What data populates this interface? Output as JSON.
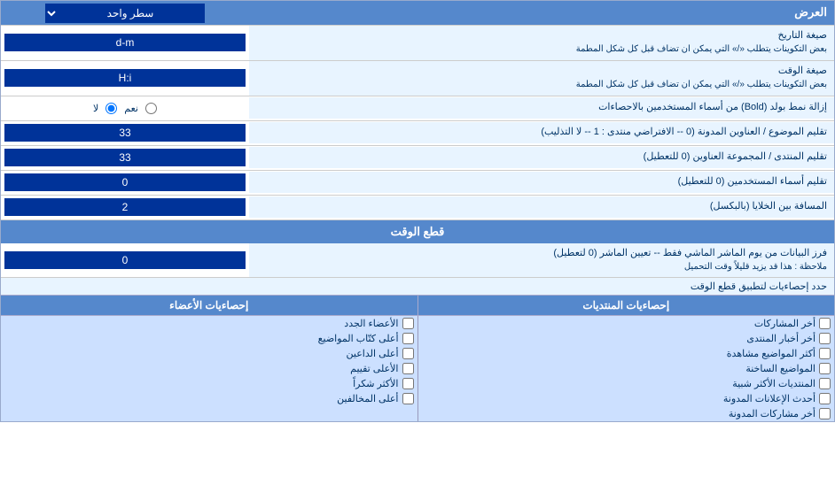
{
  "header": {
    "title": "العرض",
    "dropdown_label": "سطر واحد"
  },
  "rows": [
    {
      "id": "date_format",
      "label": "صيغة التاريخ\nبعض التكوينات يتطلب «/» التي يمكن ان تضاف قبل كل شكل المطمة",
      "value": "d-m",
      "type": "input"
    },
    {
      "id": "time_format",
      "label": "صيغة الوقت\nبعض التكوينات يتطلب «/» التي يمكن ان تضاف قبل كل شكل المطمة",
      "value": "H:i",
      "type": "input"
    },
    {
      "id": "bold_remove",
      "label": "إزالة نمط بولد (Bold) من أسماء المستخدمين بالاحصاءات",
      "radio_yes": "نعم",
      "radio_no": "لا",
      "selected": "no",
      "type": "radio"
    },
    {
      "id": "subject_align",
      "label": "تقليم الموضوع / العناوين المدونة (0 -- الافتراضي منتدى : 1 -- لا التذليب)",
      "value": "33",
      "type": "input"
    },
    {
      "id": "forum_align",
      "label": "تقليم المنتدى / المجموعة العناوين (0 للتعطيل)",
      "value": "33",
      "type": "input"
    },
    {
      "id": "user_align",
      "label": "تقليم أسماء المستخدمين (0 للتعطيل)",
      "value": "0",
      "type": "input"
    },
    {
      "id": "cell_spacing",
      "label": "المسافة بين الخلايا (بالبكسل)",
      "value": "2",
      "type": "input"
    }
  ],
  "cutoff_section": {
    "header": "قطع الوقت",
    "row": {
      "label": "فرز البيانات من يوم الماشر الماشي فقط -- تعيين الماشر (0 لتعطيل)\nملاحظة : هذا قد يزيد قليلاً وقت التحميل",
      "value": "0",
      "type": "input"
    },
    "limit_label": "حدد إحصاءيات لتطبيق قطع الوقت"
  },
  "stats_columns": [
    {
      "id": "col_shares",
      "header": "إحصاءيات المنتديات",
      "items": [
        {
          "id": "last_shares",
          "label": "أخر المشاركات"
        },
        {
          "id": "last_forum_news",
          "label": "أخر أخبار المنتدى"
        },
        {
          "id": "most_viewed",
          "label": "أكثر المواضيع مشاهدة"
        },
        {
          "id": "last_topics",
          "label": "المواضيع الساخنة"
        },
        {
          "id": "similar_forums",
          "label": "المنتديات الأكثر شبية"
        },
        {
          "id": "latest_ads",
          "label": "أحدث الإعلانات المدونة"
        },
        {
          "id": "last_tagged",
          "label": "أخر مشاركات المدونة"
        }
      ]
    },
    {
      "id": "col_members",
      "header": "إحصاءيات الأعضاء",
      "items": [
        {
          "id": "new_members",
          "label": "الأعضاء الجدد"
        },
        {
          "id": "top_posters",
          "label": "أعلى كتّاب المواضيع"
        },
        {
          "id": "top_viewers",
          "label": "أعلى الداعين"
        },
        {
          "id": "top_rated",
          "label": "الأعلى تقييم"
        },
        {
          "id": "most_thanks",
          "label": "الأكثر شكراً"
        },
        {
          "id": "top_lurkers",
          "label": "أعلى المخالفين"
        }
      ]
    }
  ],
  "label_yes": "نعم",
  "label_no": "لا"
}
